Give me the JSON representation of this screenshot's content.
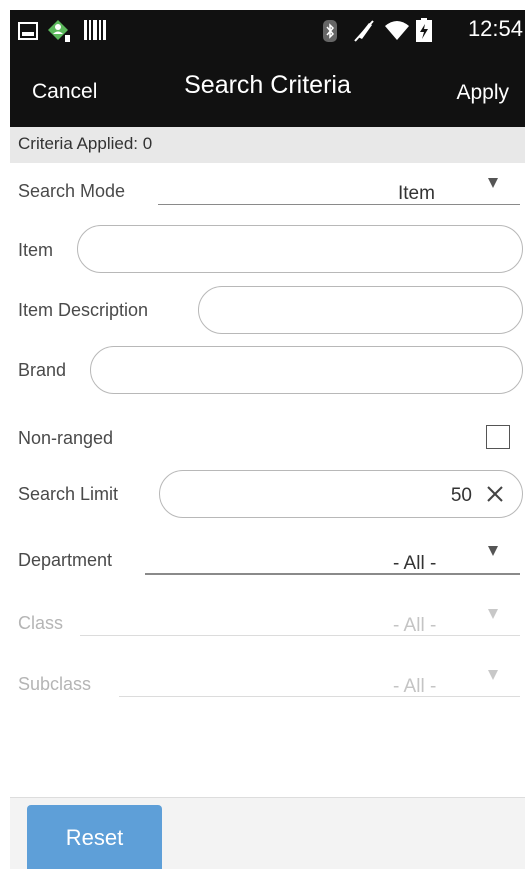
{
  "status_bar": {
    "time": "12:54",
    "icons": [
      "image-icon",
      "contact-badge-icon",
      "barcode-icon",
      "bluetooth-icon",
      "mute-icon",
      "wifi-icon",
      "battery-icon"
    ]
  },
  "header": {
    "cancel_label": "Cancel",
    "title": "Search Criteria",
    "apply_label": "Apply"
  },
  "criteria_bar": {
    "text": "Criteria Applied: 0"
  },
  "form": {
    "search_mode": {
      "label": "Search Mode",
      "value": "Item"
    },
    "item": {
      "label": "Item",
      "value": ""
    },
    "item_description": {
      "label": "Item Description",
      "value": ""
    },
    "brand": {
      "label": "Brand",
      "value": ""
    },
    "non_ranged": {
      "label": "Non-ranged",
      "checked": false
    },
    "search_limit": {
      "label": "Search Limit",
      "value": "50"
    },
    "department": {
      "label": "Department",
      "value": "- All -"
    },
    "class": {
      "label": "Class",
      "value": "- All -"
    },
    "subclass": {
      "label": "Subclass",
      "value": "- All -"
    }
  },
  "footer": {
    "reset_label": "Reset"
  },
  "colors": {
    "bar_background": "#111111",
    "criteria_background": "#e8e8e8",
    "accent": "#5e9fd8",
    "disabled_text": "#b5b5b5"
  }
}
